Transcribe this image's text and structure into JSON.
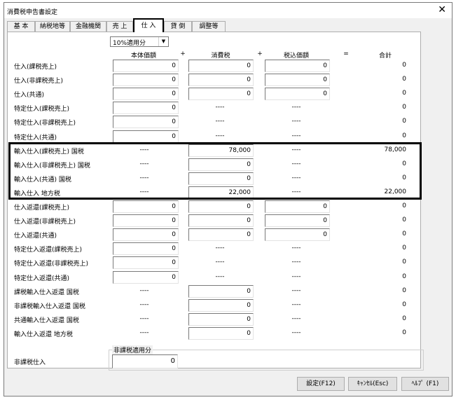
{
  "window": {
    "title": "消費税申告書設定",
    "close_icon": "close-icon"
  },
  "tabs": [
    {
      "label": "基 本"
    },
    {
      "label": "納税地等"
    },
    {
      "label": "金融機関"
    },
    {
      "label": "売 上"
    },
    {
      "label": "仕 入",
      "active": true
    },
    {
      "label": "貸 倒"
    },
    {
      "label": "調整等"
    }
  ],
  "rate_select": {
    "value": "10%適用分"
  },
  "headers": {
    "base": "本体価額",
    "plus1": "+",
    "tax": "消費税",
    "plus2": "+",
    "taxin": "税込価額",
    "eq": "=",
    "total": "合計"
  },
  "rows": [
    {
      "label": "仕入(課税売上)",
      "base": "0",
      "tax": "0",
      "taxin": "0",
      "total": "0"
    },
    {
      "label": "仕入(非課税売上)",
      "base": "0",
      "tax": "0",
      "taxin": "0",
      "total": "0"
    },
    {
      "label": "仕入(共通)",
      "base": "0",
      "tax": "0",
      "taxin": "0",
      "total": "0"
    },
    {
      "label": "特定仕入(課税売上)",
      "base": "0",
      "tax": "----",
      "taxin": "----",
      "total": "0"
    },
    {
      "label": "特定仕入(非課税売上)",
      "base": "0",
      "tax": "----",
      "taxin": "----",
      "total": "0"
    },
    {
      "label": "特定仕入(共通)",
      "base": "0",
      "tax": "----",
      "taxin": "----",
      "total": "0"
    },
    {
      "label": "輸入仕入(課税売上) 国税",
      "base": "----",
      "tax": "78,000",
      "taxin": "----",
      "total": "78,000"
    },
    {
      "label": "輸入仕入(非課税売上) 国税",
      "base": "----",
      "tax": "0",
      "taxin": "----",
      "total": "0"
    },
    {
      "label": "輸入仕入(共通) 国税",
      "base": "----",
      "tax": "0",
      "taxin": "----",
      "total": "0"
    },
    {
      "label": "輸入仕入 地方税",
      "base": "----",
      "tax": "22,000",
      "taxin": "----",
      "total": "22,000"
    },
    {
      "label": "仕入返還(課税売上)",
      "base": "0",
      "tax": "0",
      "taxin": "0",
      "total": "0"
    },
    {
      "label": "仕入返還(非課税売上)",
      "base": "0",
      "tax": "0",
      "taxin": "0",
      "total": "0"
    },
    {
      "label": "仕入返還(共通)",
      "base": "0",
      "tax": "0",
      "taxin": "0",
      "total": "0"
    },
    {
      "label": "特定仕入返還(課税売上)",
      "base": "0",
      "tax": "----",
      "taxin": "----",
      "total": "0"
    },
    {
      "label": "特定仕入返還(非課税売上)",
      "base": "0",
      "tax": "----",
      "taxin": "----",
      "total": "0"
    },
    {
      "label": "特定仕入返還(共通)",
      "base": "0",
      "tax": "----",
      "taxin": "----",
      "total": "0"
    },
    {
      "label": "課税輸入仕入返還 国税",
      "base": "----",
      "tax": "0",
      "taxin": "----",
      "total": "0"
    },
    {
      "label": "非課税輸入仕入返還 国税",
      "base": "----",
      "tax": "0",
      "taxin": "----",
      "total": "0"
    },
    {
      "label": "共通輸入仕入返還 国税",
      "base": "----",
      "tax": "0",
      "taxin": "----",
      "total": "0"
    },
    {
      "label": "輸入仕入返還 地方税",
      "base": "----",
      "tax": "0",
      "taxin": "----",
      "total": "0"
    }
  ],
  "nontax": {
    "group_title": "非課税適用分",
    "label": "非課税仕入",
    "value": "0"
  },
  "buttons": {
    "ok": "設定(F12)",
    "cancel": "ｷｬﾝｾﾙ(Esc)",
    "help": "ﾍﾙﾌﾟ (F1)"
  }
}
